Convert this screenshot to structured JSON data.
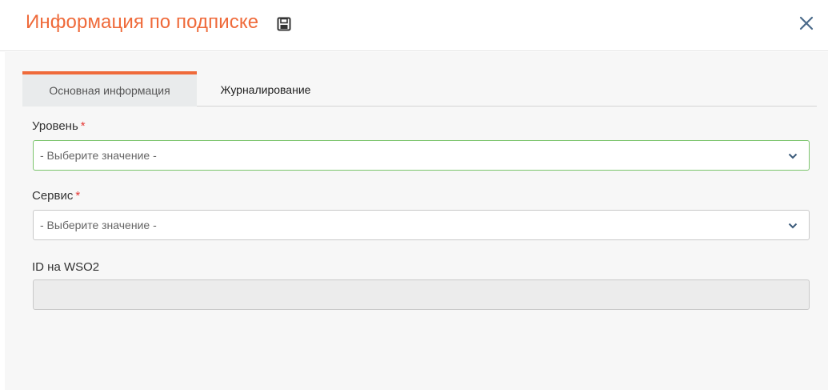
{
  "dialog": {
    "title": "Информация по подписке",
    "save_icon": "save-icon",
    "close_icon": "close-icon"
  },
  "tabs": [
    {
      "label": "Основная информация",
      "active": true
    },
    {
      "label": "Журналирование",
      "active": false
    }
  ],
  "form": {
    "level": {
      "label": "Уровень",
      "required_mark": "*",
      "placeholder": "- Выберите значение -"
    },
    "service": {
      "label": "Сервис",
      "required_mark": "*",
      "placeholder": "- Выберите значение -"
    },
    "wso2_id": {
      "label": "ID на WSO2",
      "value": ""
    }
  },
  "colors": {
    "accent": "#ef6a3a",
    "required": "#e53935",
    "focus_border": "#7bc46c"
  }
}
